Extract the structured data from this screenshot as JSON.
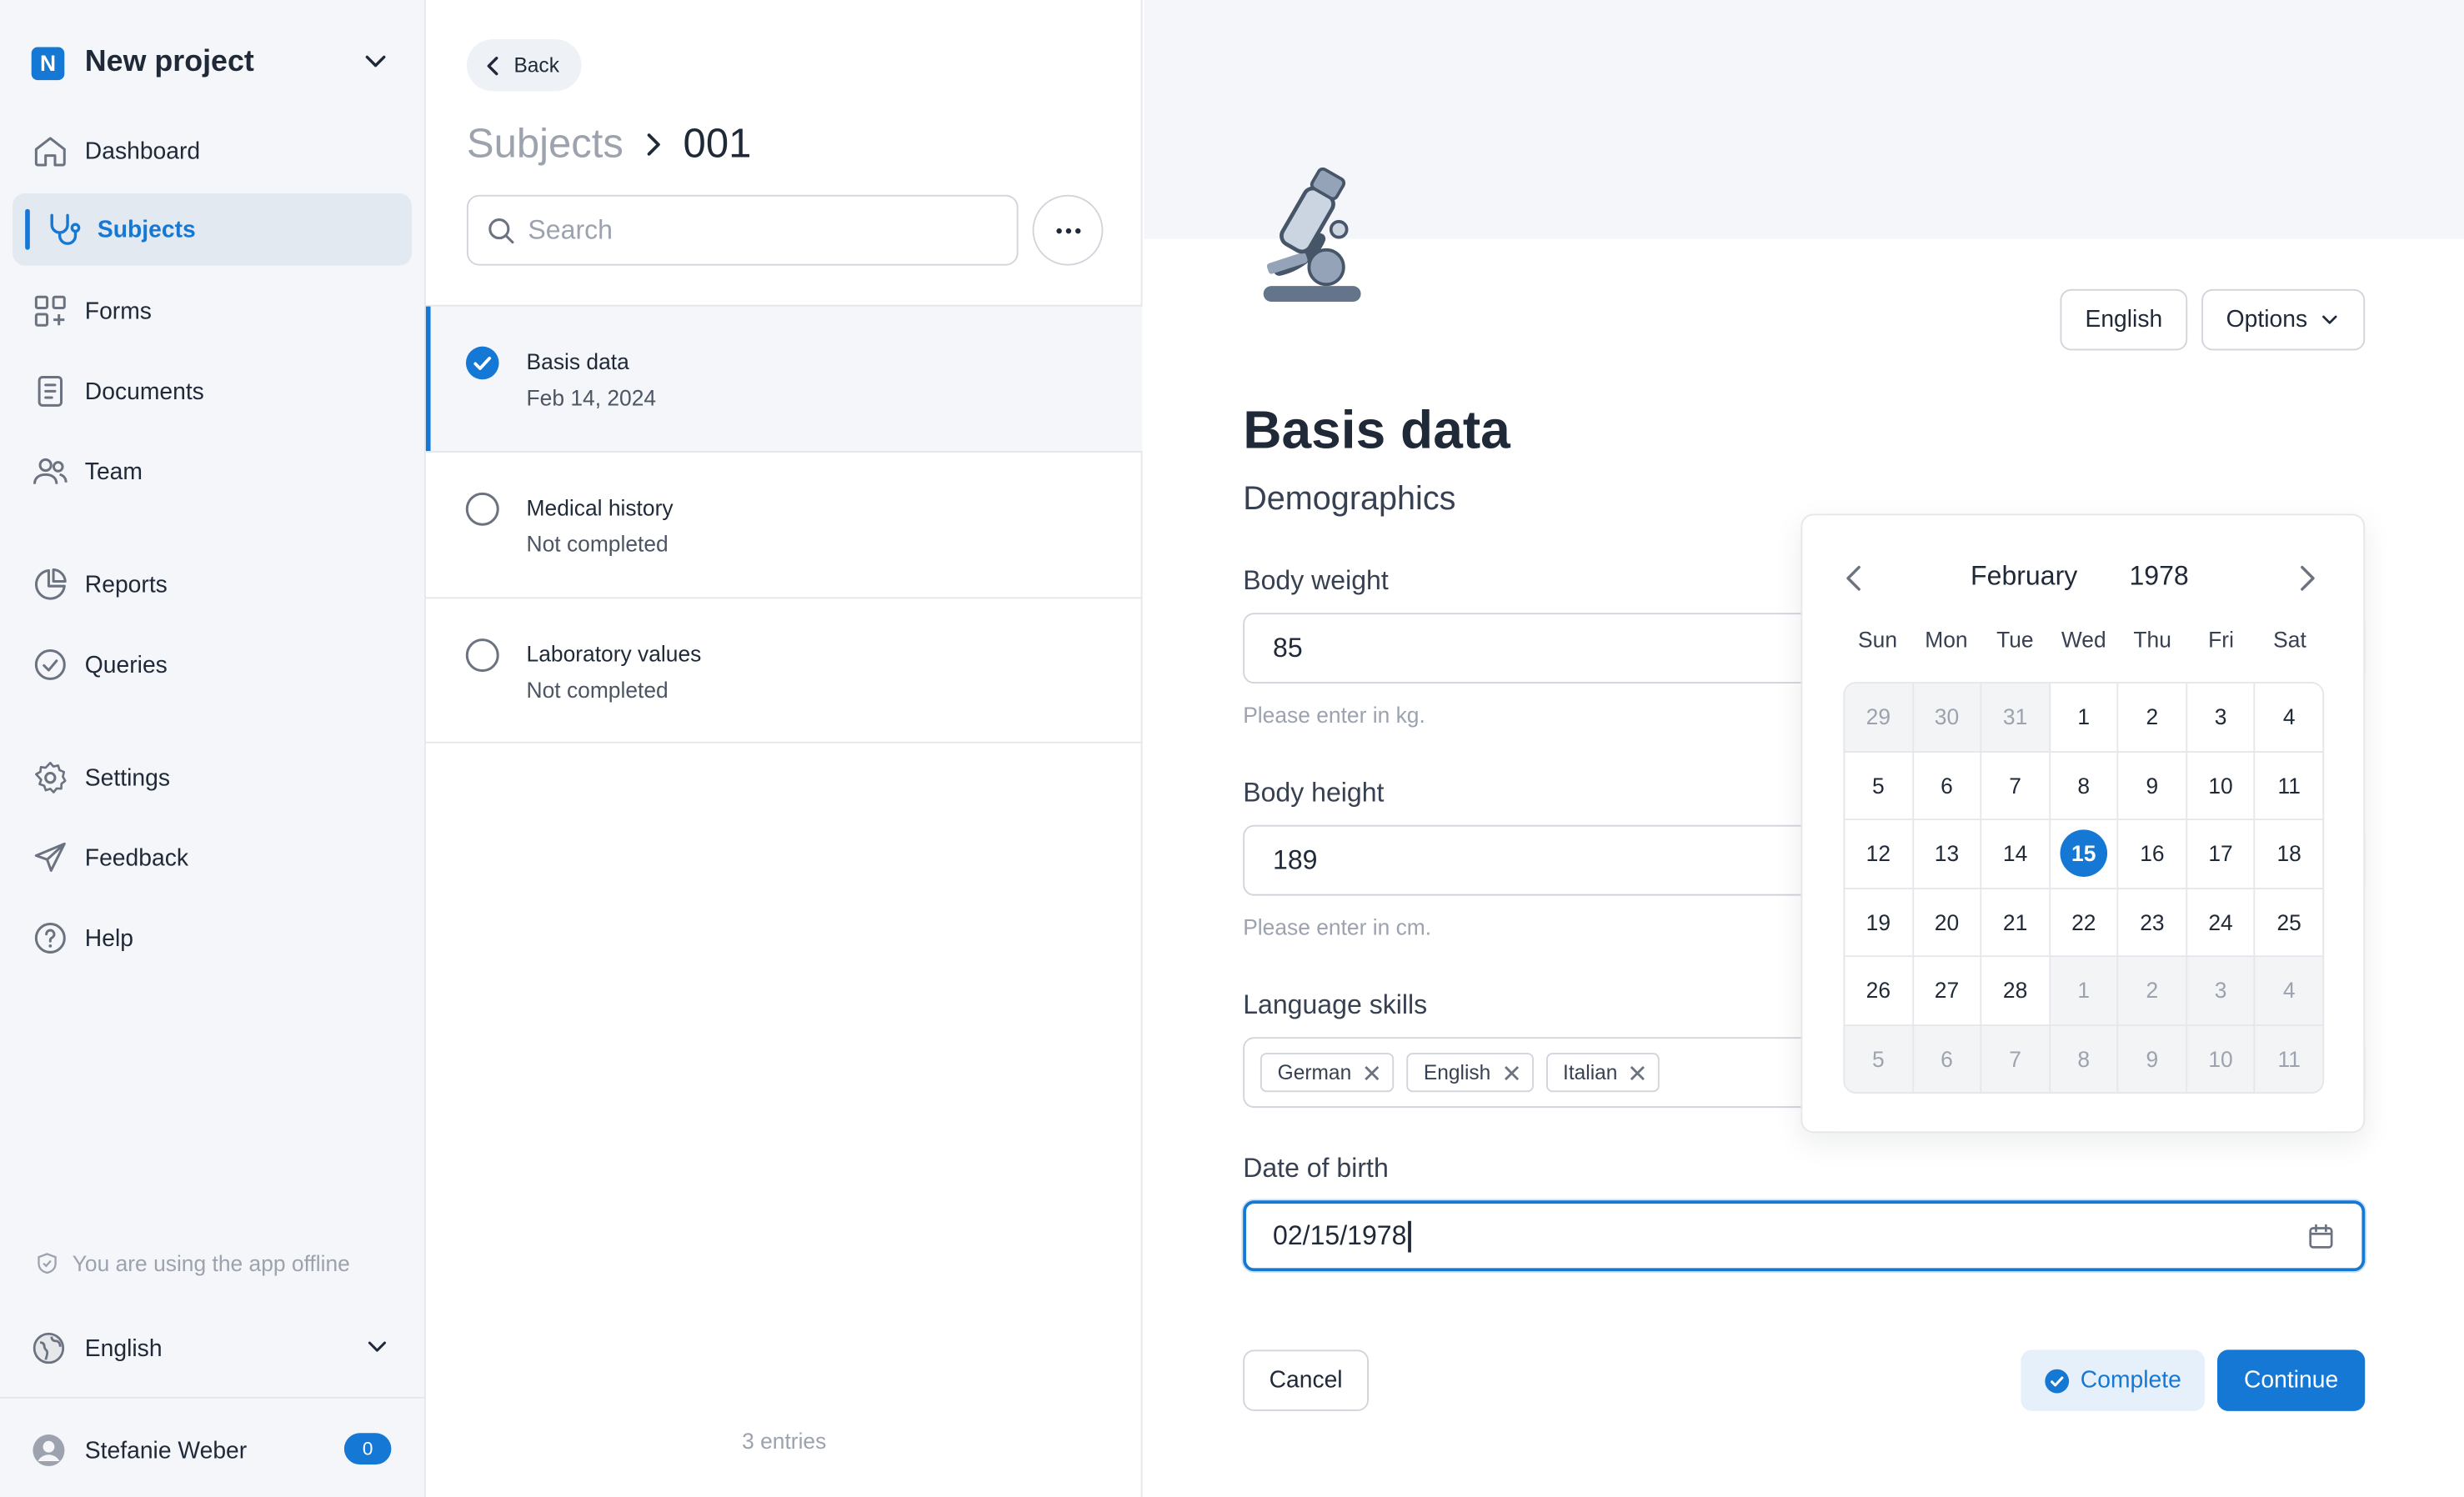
{
  "sidebar": {
    "project_logo": "N",
    "project_name": "New project",
    "items": [
      {
        "label": "Dashboard",
        "icon": "home-icon"
      },
      {
        "label": "Subjects",
        "icon": "stethoscope-icon",
        "active": true
      },
      {
        "label": "Forms",
        "icon": "grid-plus-icon"
      },
      {
        "label": "Documents",
        "icon": "document-icon"
      },
      {
        "label": "Team",
        "icon": "users-icon"
      },
      {
        "label": "Reports",
        "icon": "pie-chart-icon"
      },
      {
        "label": "Queries",
        "icon": "check-circle-icon"
      },
      {
        "label": "Settings",
        "icon": "gear-icon"
      },
      {
        "label": "Feedback",
        "icon": "paper-plane-icon"
      },
      {
        "label": "Help",
        "icon": "question-circle-icon"
      }
    ],
    "offline_text": "You are using the app offline",
    "language": "English",
    "user_name": "Stefanie Weber",
    "notification_count": "0"
  },
  "middle": {
    "back_label": "Back",
    "breadcrumb_parent": "Subjects",
    "breadcrumb_current": "001",
    "search_placeholder": "Search",
    "items": [
      {
        "title": "Basis data",
        "subtitle": "Feb 14, 2024",
        "completed": true
      },
      {
        "title": "Medical history",
        "subtitle": "Not completed",
        "completed": false
      },
      {
        "title": "Laboratory values",
        "subtitle": "Not completed",
        "completed": false
      }
    ],
    "entries_text": "3 entries"
  },
  "main": {
    "language_button": "English",
    "options_button": "Options",
    "title": "Basis data",
    "section": "Demographics",
    "fields": {
      "weight_label": "Body weight",
      "weight_value": "85",
      "weight_help": "Please enter in kg.",
      "height_label": "Body height",
      "height_value": "189",
      "height_help": "Please enter in cm.",
      "lang_label": "Language skills",
      "tags": [
        "German",
        "English",
        "Italian"
      ],
      "dob_label": "Date of birth",
      "dob_value": "02/15/1978"
    },
    "cancel_label": "Cancel",
    "complete_label": "Complete",
    "continue_label": "Continue"
  },
  "calendar": {
    "month": "February",
    "year": "1978",
    "weekdays": [
      "Sun",
      "Mon",
      "Tue",
      "Wed",
      "Thu",
      "Fri",
      "Sat"
    ],
    "days": [
      [
        "29",
        "30",
        "31",
        "1",
        "2",
        "3",
        "4"
      ],
      [
        "5",
        "6",
        "7",
        "8",
        "9",
        "10",
        "11"
      ],
      [
        "12",
        "13",
        "14",
        "15",
        "16",
        "17",
        "18"
      ],
      [
        "19",
        "20",
        "21",
        "22",
        "23",
        "24",
        "25"
      ],
      [
        "26",
        "27",
        "28",
        "1",
        "2",
        "3",
        "4"
      ],
      [
        "5",
        "6",
        "7",
        "8",
        "9",
        "10",
        "11"
      ]
    ],
    "outside_first_row_count": 3,
    "outside_from_row4_index": 3,
    "selected_day": "15",
    "accent_color": "#1478d4"
  }
}
